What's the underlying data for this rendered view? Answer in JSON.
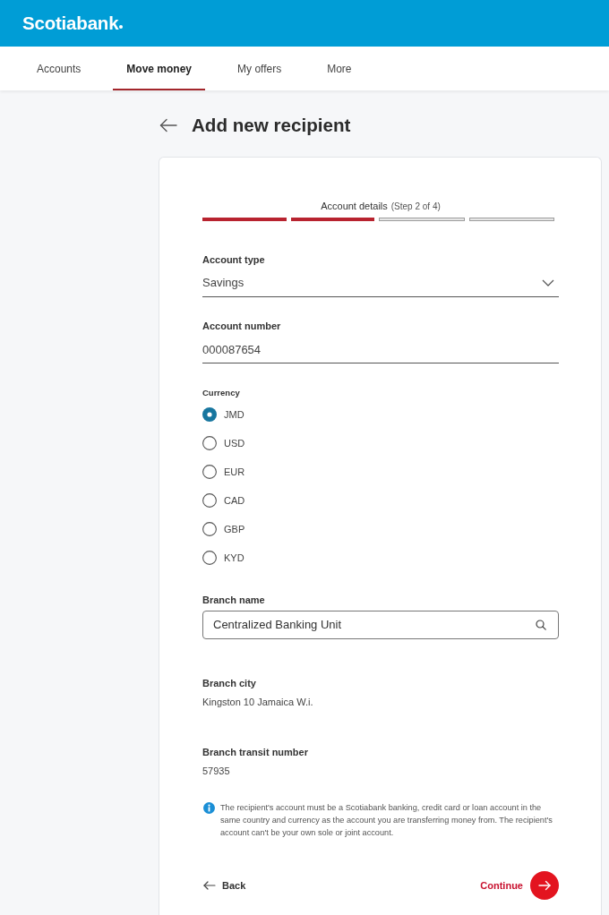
{
  "header": {
    "logo": "Scotiabank"
  },
  "nav": {
    "tabs": [
      {
        "label": "Accounts",
        "selected": false
      },
      {
        "label": "Move money",
        "selected": true
      },
      {
        "label": "My offers",
        "selected": false
      },
      {
        "label": "More",
        "selected": false
      }
    ]
  },
  "page": {
    "title": "Add new recipient"
  },
  "stepper": {
    "title": "Account details",
    "step": "(Step 2 of 4)",
    "segments": [
      {
        "complete": true
      },
      {
        "complete": true
      },
      {
        "complete": false
      },
      {
        "complete": false
      }
    ]
  },
  "fields": [
    {
      "kind": "select",
      "label": "Account type",
      "value": "Savings"
    },
    {
      "kind": "text",
      "label": "Account number",
      "value": "000087654"
    },
    {
      "kind": "radio",
      "label": "Currency",
      "options": [
        {
          "label": "JMD",
          "selected": true
        },
        {
          "label": "USD",
          "selected": false
        },
        {
          "label": "EUR",
          "selected": false
        },
        {
          "label": "CAD",
          "selected": false
        },
        {
          "label": "GBP",
          "selected": false
        },
        {
          "label": "KYD",
          "selected": false
        }
      ]
    },
    {
      "kind": "search",
      "label": "Branch name",
      "value": "Centralized Banking Unit"
    },
    {
      "kind": "static",
      "label": "Branch city",
      "value": "Kingston 10 Jamaica W.i."
    },
    {
      "kind": "static",
      "label": "Branch transit number",
      "value": "57935"
    }
  ],
  "notice": {
    "text": "The recipient's account must be a Scotiabank banking, credit card or loan account in the same country and currency as the account you are transferring money from. The recipient's account can't be your own sole or joint account."
  },
  "actions": {
    "back": "Back",
    "continue": "Continue"
  }
}
